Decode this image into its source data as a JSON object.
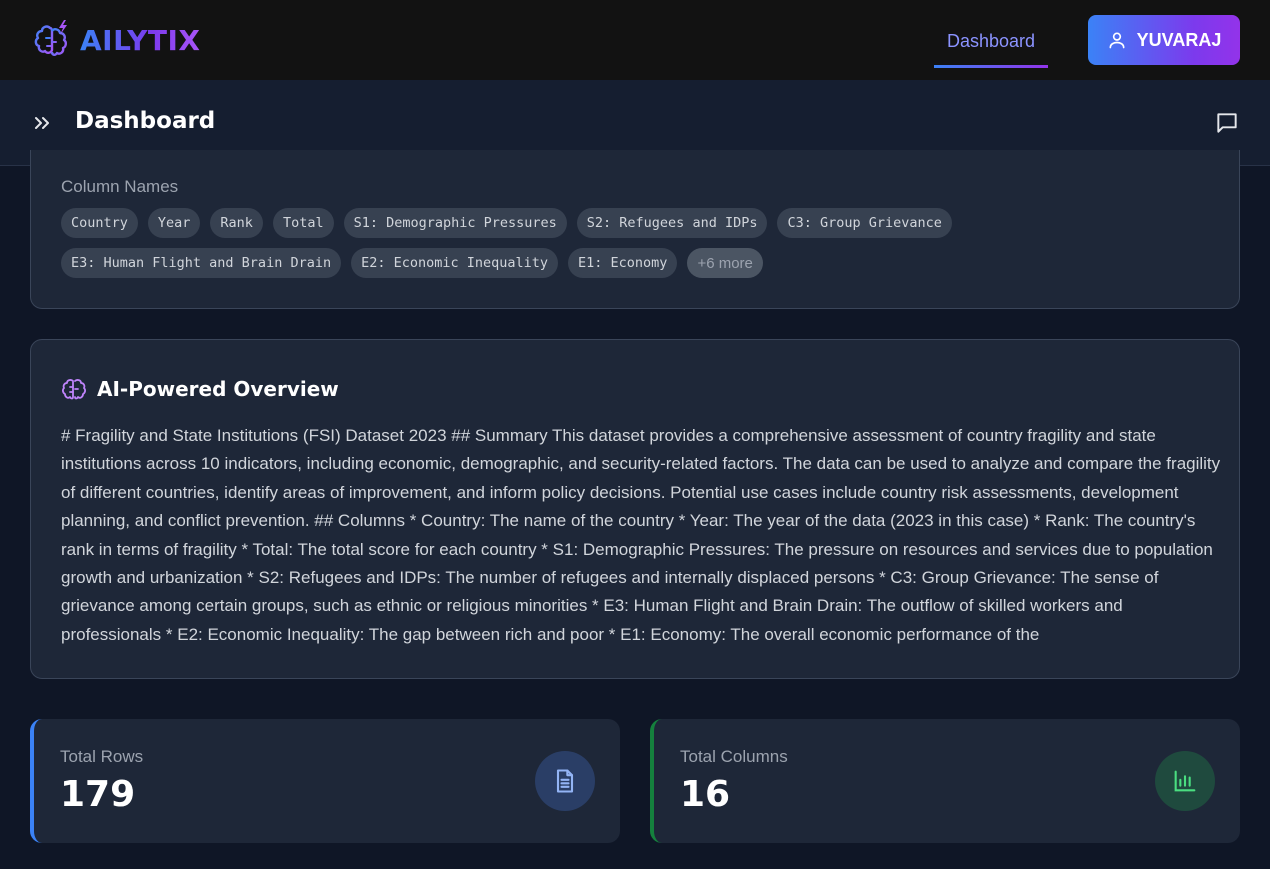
{
  "app": {
    "name": "AILYTIX",
    "logo_icon": "brain-bolt-icon"
  },
  "nav": {
    "dashboard_link": "Dashboard",
    "user_name": "YUVARAJ",
    "user_icon": "user-icon"
  },
  "header": {
    "title": "Dashboard",
    "expand_icon": "double-chevron-right-icon",
    "chat_icon": "chat-icon"
  },
  "columns_card": {
    "label": "Column Names",
    "chips": [
      "Country",
      "Year",
      "Rank",
      "Total",
      "S1: Demographic Pressures",
      "S2: Refugees and IDPs",
      "C3: Group Grievance",
      "E3: Human Flight and Brain Drain",
      "E2: Economic Inequality",
      "E1: Economy"
    ],
    "more_label": "+6 more"
  },
  "overview": {
    "title": "AI-Powered Overview",
    "icon": "brain-icon",
    "text": "# Fragility and State Institutions (FSI) Dataset 2023 ## Summary This dataset provides a comprehensive assessment of country fragility and state institutions across 10 indicators, including economic, demographic, and security-related factors. The data can be used to analyze and compare the fragility of different countries, identify areas of improvement, and inform policy decisions. Potential use cases include country risk assessments, development planning, and conflict prevention. ## Columns * Country: The name of the country * Year: The year of the data (2023 in this case) * Rank: The country's rank in terms of fragility * Total: The total score for each country * S1: Demographic Pressures: The pressure on resources and services due to population growth and urbanization * S2: Refugees and IDPs: The number of refugees and internally displaced persons * C3: Group Grievance: The sense of grievance among certain groups, such as ethnic or religious minorities * E3: Human Flight and Brain Drain: The outflow of skilled workers and professionals * E2: Economic Inequality: The gap between rich and poor * E1: Economy: The overall economic performance of the"
  },
  "stats": {
    "rows": {
      "label": "Total Rows",
      "value": "179",
      "icon": "document-icon",
      "accent": "#3b82f6"
    },
    "columns": {
      "label": "Total Columns",
      "value": "16",
      "icon": "bar-chart-icon",
      "accent": "#15803d"
    }
  },
  "colors": {
    "background": "#0f1626",
    "card": "#1e2738",
    "brand_gradient_start": "#3b82f6",
    "brand_gradient_end": "#9333ea"
  }
}
